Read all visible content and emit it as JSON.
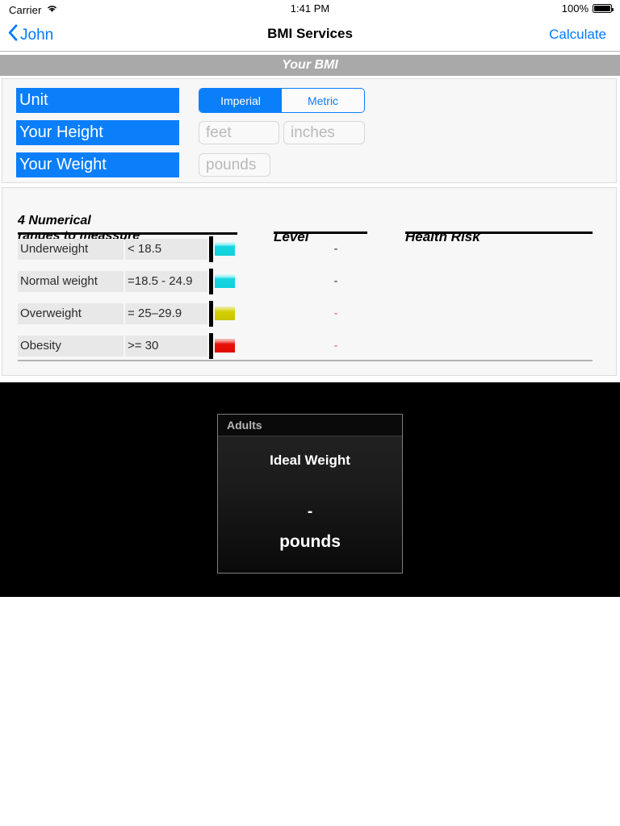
{
  "status_bar": {
    "carrier": "Carrier",
    "wifi_icon": "wifi-icon",
    "time": "1:41 PM",
    "battery_percent": "100%",
    "battery_icon": "battery-full-icon"
  },
  "nav_bar": {
    "back_icon": "chevron-left-icon",
    "back_label": "John",
    "title": "BMI Services",
    "action_label": "Calculate"
  },
  "section_header": {
    "title": "Your BMI"
  },
  "form": {
    "unit": {
      "label": "Unit",
      "options": [
        "Imperial",
        "Metric"
      ],
      "selected": "Imperial"
    },
    "height": {
      "label": "Your Height",
      "feet_placeholder": "feet",
      "feet_value": "",
      "inches_placeholder": "inches",
      "inches_value": ""
    },
    "weight": {
      "label": "Your Weight",
      "pounds_placeholder": "pounds",
      "pounds_value": ""
    }
  },
  "ranges_table": {
    "headers": {
      "ranges": "4 Numerical\nranges to meassure",
      "level": "Level",
      "health_risk": "Health Risk"
    },
    "rows": [
      {
        "category": "Underweight",
        "range": "< 18.5",
        "swatch_color": "#16d6e0",
        "swatch_name": "cyan",
        "level": "-",
        "level_color": "#333333",
        "health_risk": ""
      },
      {
        "category": "Normal weight",
        "range": "=18.5 - 24.9",
        "swatch_color": "#16d6e0",
        "swatch_name": "cyan",
        "level": "-",
        "level_color": "#333333",
        "health_risk": ""
      },
      {
        "category": "Overweight",
        "range": "= 25–29.9",
        "swatch_color": "#d4cf00",
        "swatch_name": "yellow",
        "level": "-",
        "level_color": "#f4615c",
        "health_risk": ""
      },
      {
        "category": "Obesity",
        "range": ">= 30",
        "swatch_color": "#e81209",
        "swatch_name": "red",
        "level": "-",
        "level_color": "#f4615c",
        "health_risk": ""
      }
    ]
  },
  "result_card": {
    "header": "Adults",
    "title": "Ideal Weight",
    "value": "-",
    "unit": "pounds"
  },
  "colors": {
    "accent_blue": "#007aff",
    "label_blue": "#0b7efa",
    "section_bar_gray": "#a9a9a9",
    "panel_bg": "#f7f7f7",
    "cell_bg": "#e8e8e8"
  }
}
